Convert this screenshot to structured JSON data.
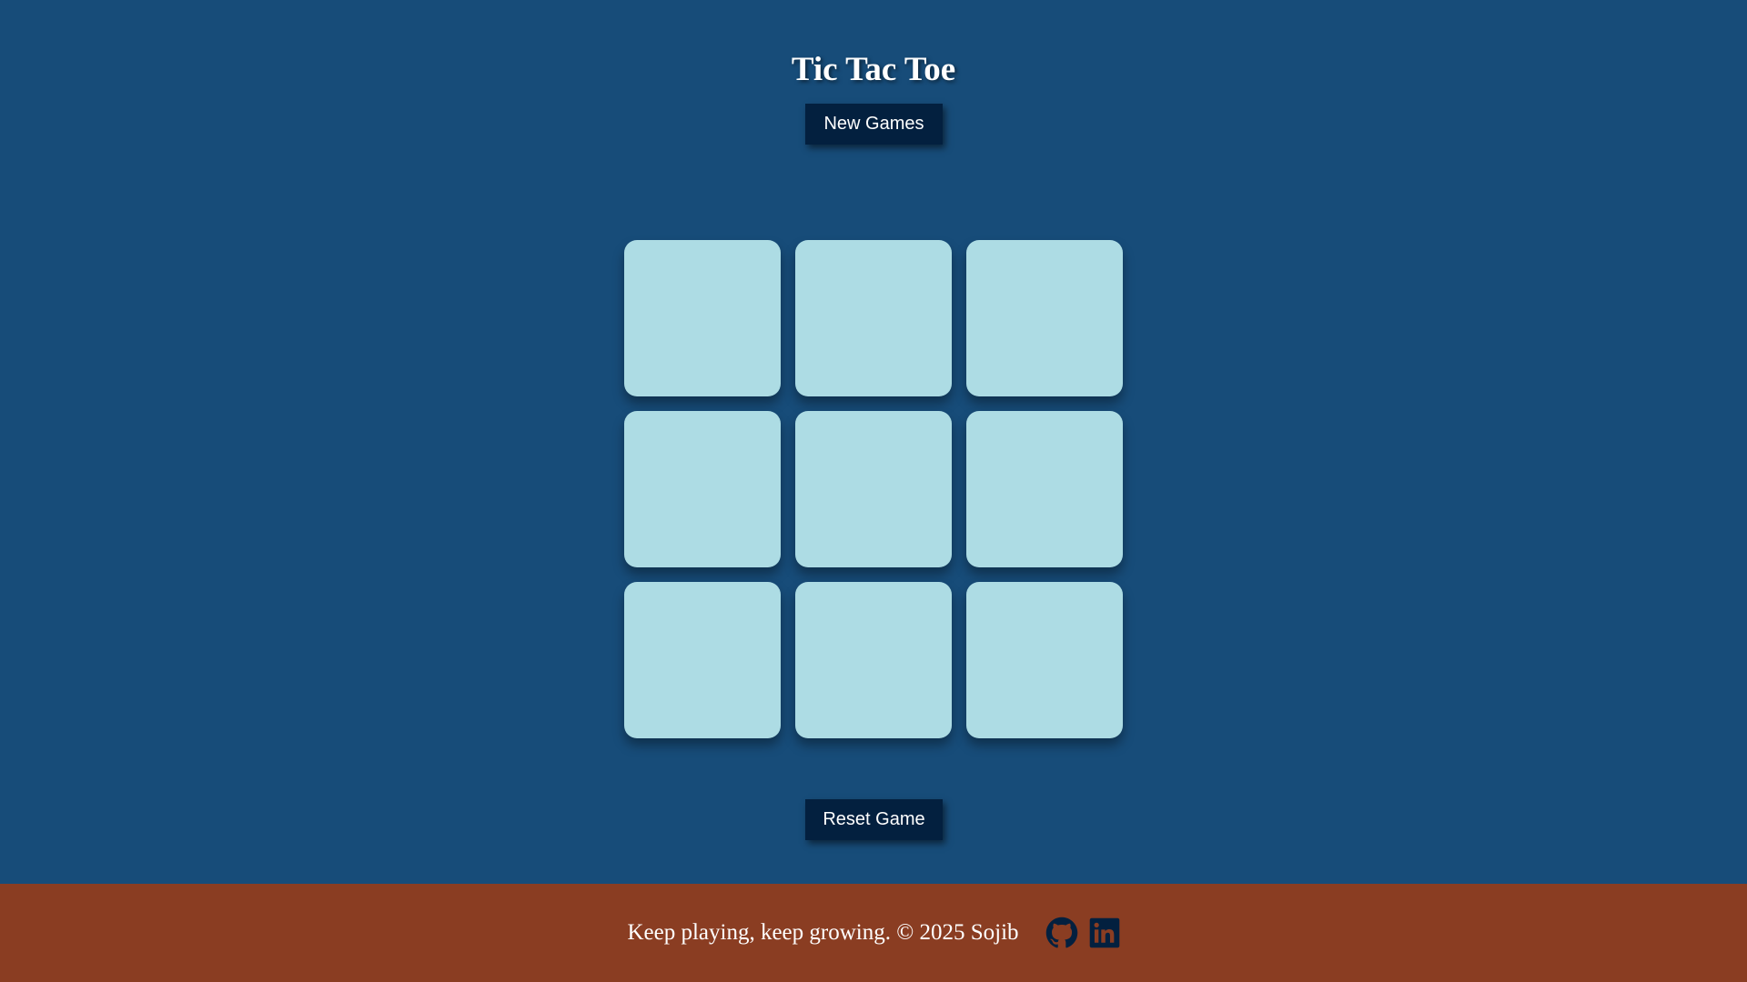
{
  "header": {
    "title": "Tic Tac Toe",
    "new_game_label": "New Games"
  },
  "board": {
    "cells": [
      "",
      "",
      "",
      "",
      "",
      "",
      "",
      "",
      ""
    ]
  },
  "controls": {
    "reset_label": "Reset Game"
  },
  "footer": {
    "text": "Keep playing, keep growing. © 2025 Sojib",
    "icons": [
      "github-icon",
      "linkedin-icon"
    ]
  },
  "colors": {
    "background": "#174c79",
    "button": "#03203f",
    "cell": "#addce4",
    "footer": "#8a3d22",
    "text": "#ffffff"
  }
}
